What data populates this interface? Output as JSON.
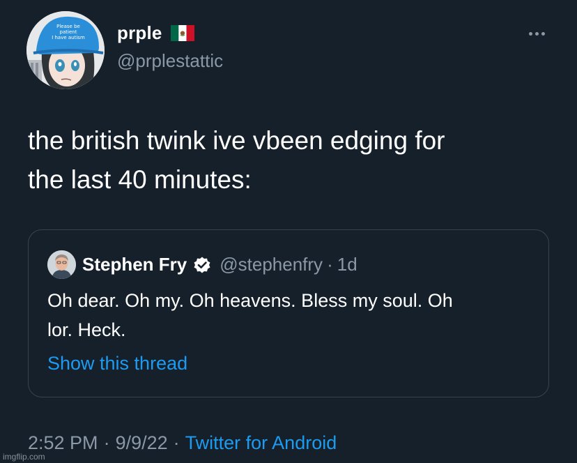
{
  "author": {
    "display_name": "prple",
    "handle": "@prplestattic",
    "flag_icon": "mexico-flag-icon",
    "avatar_hat_text": [
      "Please be",
      "patient",
      "I have autism"
    ]
  },
  "tweet": {
    "text_lines": [
      "the british twink ive vbeen edging for",
      "the last 40 minutes:"
    ]
  },
  "quote": {
    "display_name": "Stephen Fry",
    "handle": "@stephenfry",
    "separator": "·",
    "time": "1d",
    "text_lines": [
      "Oh dear. Oh my. Oh heavens. Bless my soul. Oh",
      "lor. Heck."
    ],
    "show_thread": "Show this thread",
    "verified_icon": "verified-badge-icon"
  },
  "meta": {
    "time": "2:52 PM",
    "separator": "·",
    "date": "9/9/22",
    "source": "Twitter for Android"
  },
  "watermark": "imgflip.com",
  "colors": {
    "background": "#15202b",
    "text_primary": "#ffffff",
    "text_secondary": "#8b98a5",
    "link": "#1d9bf0",
    "border": "#38444d"
  }
}
